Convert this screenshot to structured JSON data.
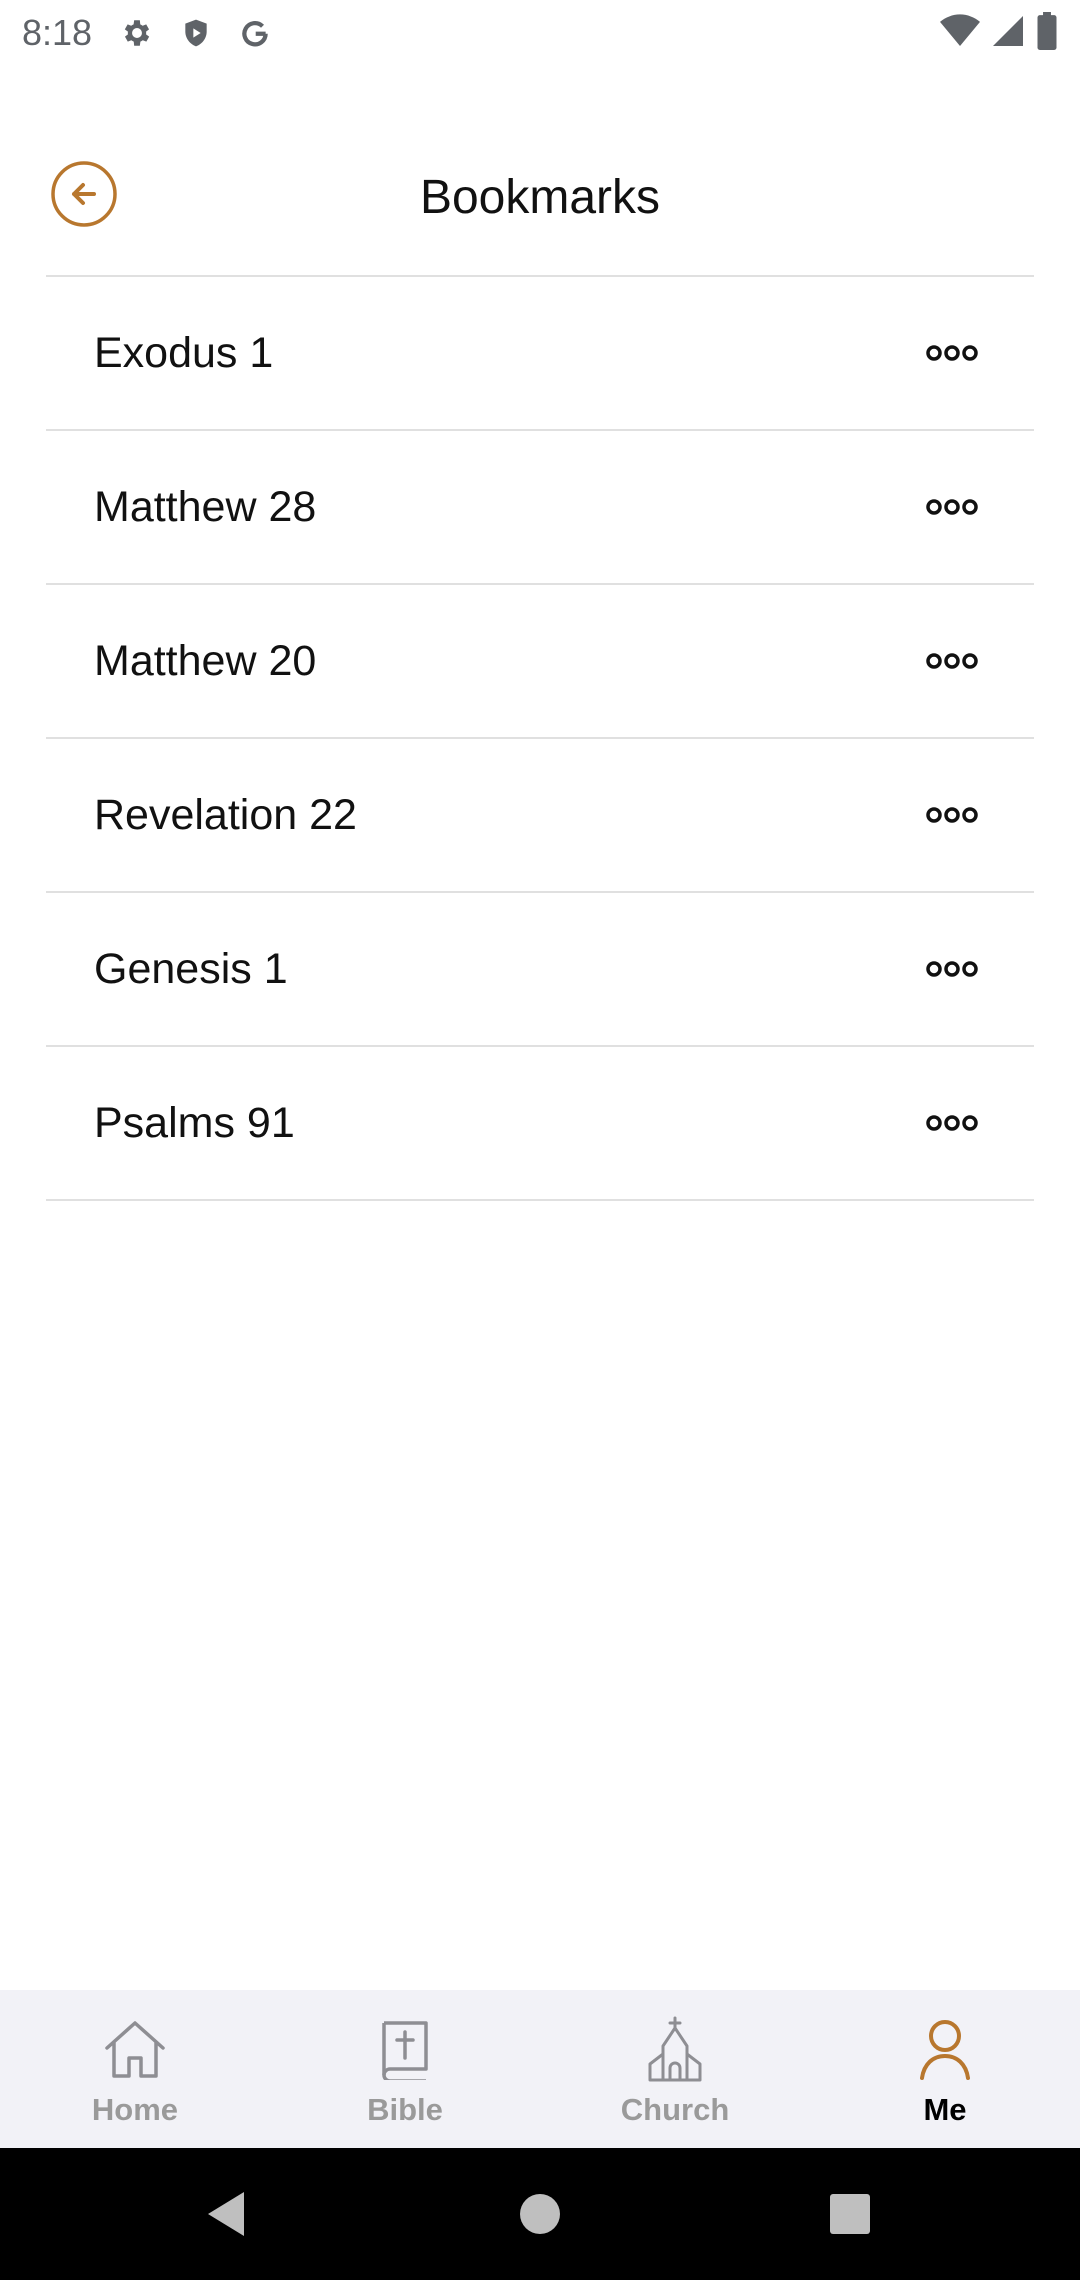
{
  "status_bar": {
    "time": "8:18",
    "left_icons": [
      "settings-icon",
      "shield-icon",
      "google-icon"
    ],
    "right_icons": [
      "wifi-icon",
      "signal-icon",
      "battery-icon"
    ]
  },
  "header": {
    "title": "Bookmarks",
    "back_icon": "arrow-left-circle-icon",
    "accent_color": "#B8772E"
  },
  "bookmarks": [
    {
      "label": "Exodus 1"
    },
    {
      "label": "Matthew 28"
    },
    {
      "label": "Matthew 20"
    },
    {
      "label": "Revelation 22"
    },
    {
      "label": "Genesis 1"
    },
    {
      "label": "Psalms 91"
    }
  ],
  "tab_bar": {
    "tabs": [
      {
        "label": "Home",
        "icon": "home-icon",
        "active": false
      },
      {
        "label": "Bible",
        "icon": "bible-icon",
        "active": false
      },
      {
        "label": "Church",
        "icon": "church-icon",
        "active": false
      },
      {
        "label": "Me",
        "icon": "person-icon",
        "active": true
      }
    ],
    "inactive_color": "#9A9A9A",
    "active_color": "#B8772E"
  },
  "nav_bar": {
    "buttons": [
      "back-triangle-icon",
      "home-circle-icon",
      "recents-square-icon"
    ]
  }
}
